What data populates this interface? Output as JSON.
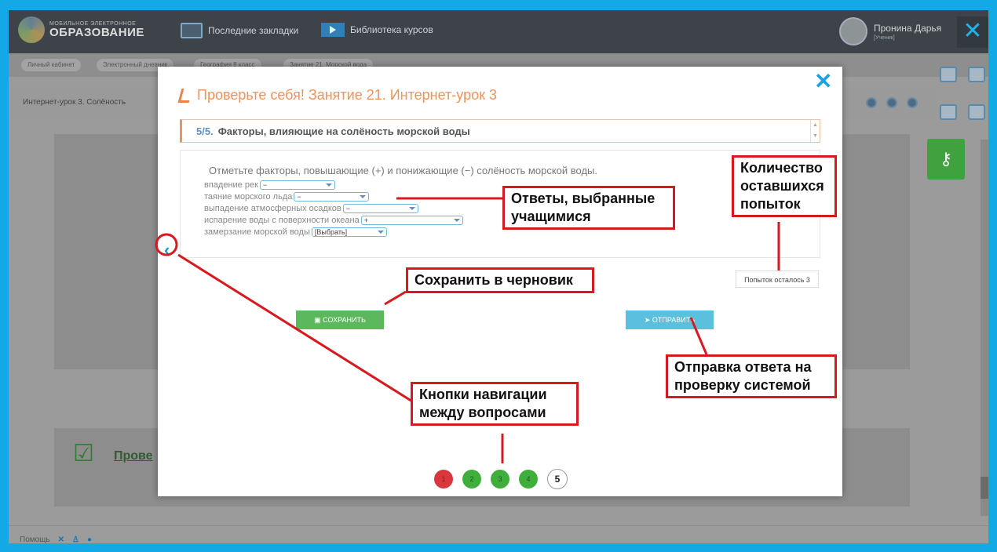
{
  "app": {
    "logo_small": "МОБИЛЬНОЕ ЭЛЕКТРОННОЕ",
    "logo_big": "ОБРАЗОВАНИЕ",
    "nav": [
      {
        "label": "Последние закладки",
        "icon": "bookmarks-icon"
      },
      {
        "label": "Библиотека курсов",
        "icon": "video-library-icon"
      }
    ],
    "user": {
      "name": "Пронина Дарья",
      "role": "[Ученик]"
    },
    "close_label": "✕"
  },
  "background": {
    "breadcrumbs": [
      "Личный кабинет",
      "Электронный дневник",
      "География 8 класс",
      "Занятие 21. Морской вода"
    ],
    "lesson_title": "Интернет-урок 3. Солёность",
    "card_label": "Прове",
    "footer_label": "Помощь"
  },
  "modal": {
    "title": "Проверьте себя! Занятие 21. Интернет-урок 3",
    "question_number": "5/5.",
    "question_title": "Факторы, влияющие на солёность морской воды",
    "instruction": "Отметьте факторы, повышающие (+) и понижающие (−) солёность морской воды.",
    "items": [
      {
        "label": "впадение рек",
        "value": "−"
      },
      {
        "label": "таяние морского льда",
        "value": "−"
      },
      {
        "label": "выпадение атмосферных осадков",
        "value": "−"
      },
      {
        "label": "испарение воды с поверхности океана",
        "value": "+"
      },
      {
        "label": "замерзание морской воды",
        "value": "[Выбрать]"
      }
    ],
    "attempts": "Попыток осталось 3",
    "save_label": "СОХРАНИТЬ",
    "send_label": "ОТПРАВИТЬ",
    "pages": [
      {
        "n": "1",
        "state": "wrong",
        "color": "#d9363e"
      },
      {
        "n": "2",
        "state": "correct",
        "color": "#3fae3b"
      },
      {
        "n": "3",
        "state": "correct",
        "color": "#3fae3b"
      },
      {
        "n": "4",
        "state": "correct",
        "color": "#3fae3b"
      },
      {
        "n": "5",
        "state": "current",
        "color": "#ffffff"
      }
    ]
  },
  "annotations": {
    "answers": "Ответы, выбранные учащимися",
    "attempts": "Количество оставшихся попыток",
    "save": "Сохранить в черновик",
    "send": "Отправка ответа на проверку системой",
    "nav": "Кнопки навигации между вопросами"
  },
  "colors": {
    "accent": "#13a9e6",
    "annotation": "#d71920",
    "title": "#f0925b"
  }
}
